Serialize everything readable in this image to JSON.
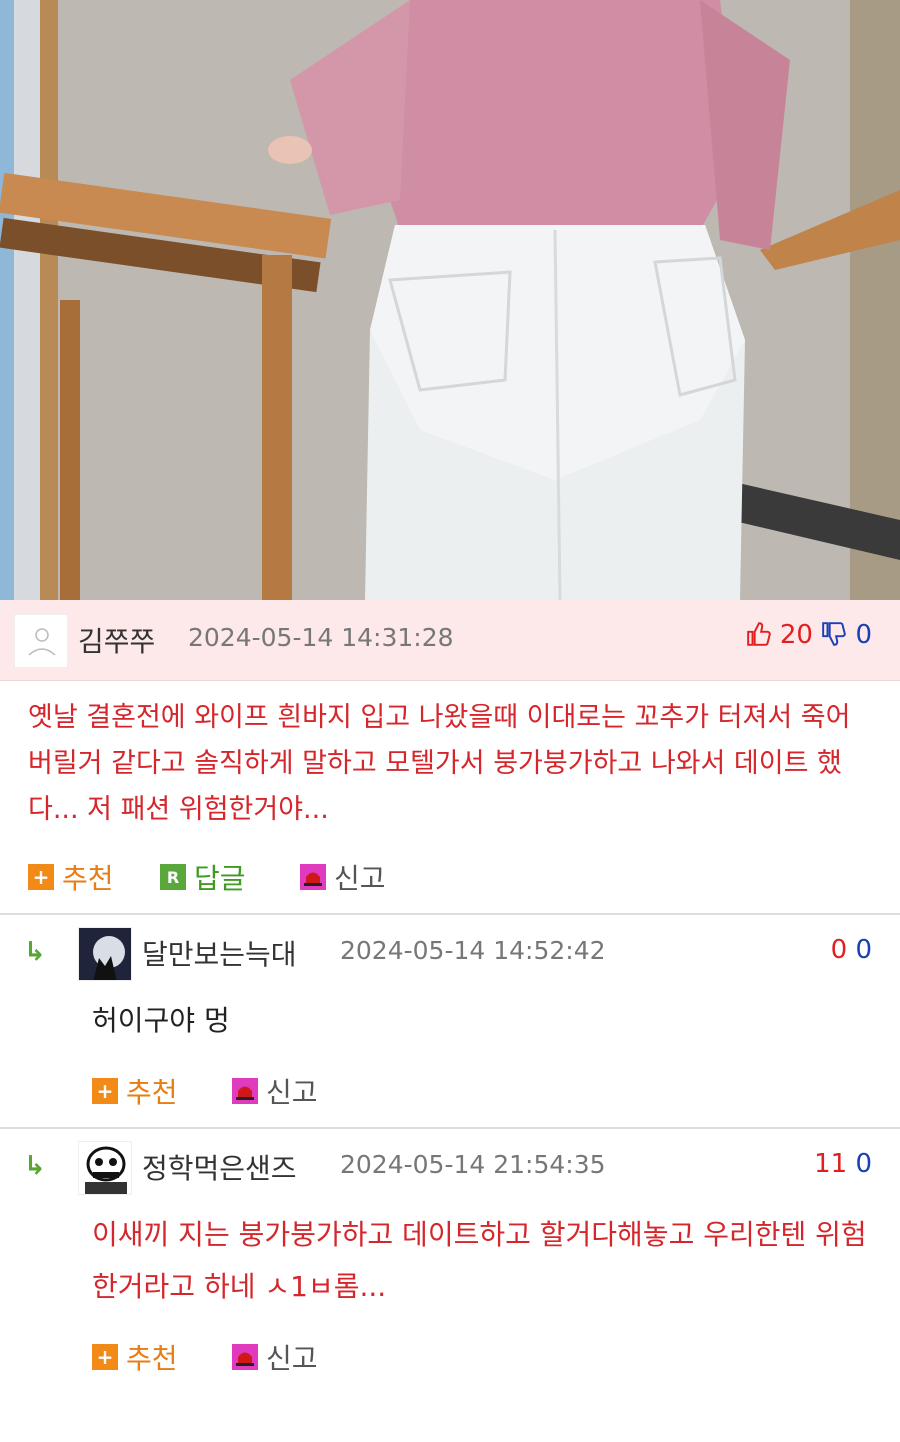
{
  "comments": [
    {
      "author": "김쭈쭈",
      "date": "2024-05-14 14:31:28",
      "up": "20",
      "down": "0",
      "text": "옛날 결혼전에 와이프 흰바지 입고 나왔을때 이대로는 꼬추가 터져서 죽어버릴거 같다고 솔직하게 말하고 모텔가서 붕가붕가하고 나와서 데이트 했다... 저 패션 위험한거야...",
      "actions": {
        "recommend": "추천",
        "reply": "답글",
        "report": "신고"
      }
    }
  ],
  "replies": [
    {
      "author": "달만보는늑대",
      "date": "2024-05-14 14:52:42",
      "up": "0",
      "down": "0",
      "text": "허이구야 멍",
      "actions": {
        "recommend": "추천",
        "report": "신고"
      }
    },
    {
      "author": "정학먹은샌즈",
      "date": "2024-05-14 21:54:35",
      "up": "11",
      "down": "0",
      "text": "이새끼 지는 붕가붕가하고 데이트하고 할거다해놓고 우리한텐 위험한거라고 하네 ㅅ1ㅂ롬...",
      "actions": {
        "recommend": "추천",
        "report": "신고"
      }
    }
  ],
  "icons": {
    "recommend": "plus-icon",
    "reply": "reply-r-icon",
    "report": "siren-icon",
    "thumbs_up": "thumbs-up-icon",
    "thumbs_down": "thumbs-down-icon",
    "reply_arrow": "reply-arrow-icon"
  },
  "colors": {
    "header_bg": "#fde8ea",
    "up": "#e02020",
    "down": "#1a3fb7",
    "red_text": "#d4262b",
    "action_orange": "#e87d12",
    "action_green": "#3f9a22"
  }
}
